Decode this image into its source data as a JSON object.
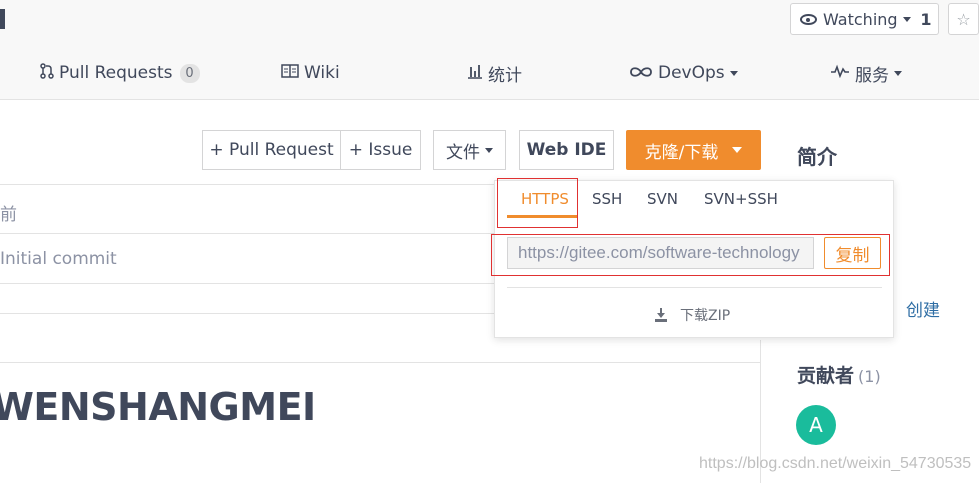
{
  "header": {
    "watch": {
      "label": "Watching",
      "count": "1"
    },
    "nav": [
      {
        "label": "Pull Requests",
        "badge": "0",
        "icon": "pull-request-icon"
      },
      {
        "label": "Wiki",
        "icon": "book-icon"
      },
      {
        "label": "统计",
        "icon": "bar-chart-icon"
      },
      {
        "label": "DevOps",
        "icon": "infinity-icon"
      },
      {
        "label": "服务",
        "icon": "pulse-icon"
      }
    ]
  },
  "toolbar": {
    "pull_request": "+ Pull Request",
    "issue": "+ Issue",
    "file": "文件",
    "web_ide": "Web IDE",
    "clone": "克隆/下载"
  },
  "sidebar": {
    "intro_title": "简介",
    "create_link": "创建",
    "contributors_label": "贡献者",
    "contributors_count": "(1)",
    "avatar_letter": "A"
  },
  "file_table": {
    "time_header": "前",
    "commit_message": "Initial commit"
  },
  "readme": {
    "title": "WENSHANGMEI"
  },
  "clone_dropdown": {
    "tabs": [
      "HTTPS",
      "SSH",
      "SVN",
      "SVN+SSH"
    ],
    "active_tab": "HTTPS",
    "url": "https://gitee.com/software-technology",
    "copy_label": "复制",
    "download_label": "下载ZIP"
  },
  "watermark": "https://blog.csdn.net/weixin_54730535",
  "colors": {
    "accent": "#f08c2d",
    "highlight_box": "#e03131",
    "avatar": "#1abc9c"
  }
}
